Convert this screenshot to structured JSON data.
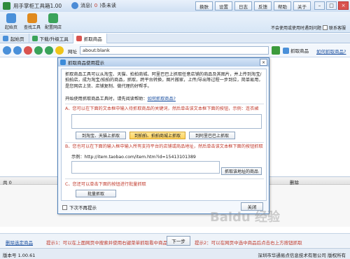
{
  "window": {
    "title": "用手掌柜工具箱1.00",
    "messages": "消息(",
    "messages_count": "0",
    "messages_suffix": ")条未读",
    "buttons": [
      "换肤",
      "设置",
      "日志",
      "反馈",
      "帮助",
      "关于"
    ],
    "minimize": "–",
    "maximize": "□",
    "close": "×"
  },
  "toolbar": {
    "items": [
      {
        "label": "起始页",
        "icon": "home-icon",
        "color": "#4a90d9"
      },
      {
        "label": "查找工具",
        "icon": "search-tool-icon",
        "color": "#e08a1e"
      },
      {
        "label": "配置网店",
        "icon": "shop-config-icon",
        "color": "#3aa35a"
      }
    ],
    "auto_login_label": "不会使用或使用时遇到问题",
    "auto_login_link": "联系客服"
  },
  "tabs": [
    {
      "label": "起始页",
      "active": false,
      "icon": "home-tab-icon",
      "color": "#4a90d9"
    },
    {
      "label": "下载/升级工具",
      "active": false,
      "icon": "download-icon",
      "color": "#3aa35a"
    },
    {
      "label": "抓取商品",
      "active": true,
      "icon": "grab-icon",
      "color": "#d9534f"
    }
  ],
  "navbar": {
    "url_label": "网址",
    "url_value": "about:blank",
    "grab_label": "抓取商品",
    "howto_link": "如何抓取商品?"
  },
  "grid": {
    "columns": [
      "共 0",
      "删除"
    ]
  },
  "footer": {
    "delete_selected": "删除选定商品",
    "tip1": "提示1：可以在上面网页中搜索并使用右键菜单抓取看中商品",
    "next_button": "下一步",
    "tip2": "提示2：可以在网页中选中商品后点击右上方按钮抓取"
  },
  "status": {
    "version": "版本号 1.00.61",
    "copyright": "深圳市华通易点信息技术有限公司 版权所有"
  },
  "dialog": {
    "title": "抓取商品使用提示",
    "intro": "抓取商品工具可以从淘宝、天猫、拍拍商城、阿里巴巴上抓取任意店铺的商品及其图片，并上传到淘宝/拍拍店，成为淘宝/拍拍的商品，抓取，跨平台转换，图片搬家，上传/导出等过程一步到位，简单易用，是您网店上货、店铺复制、做代理的好帮手。",
    "help_prefix": "开始使用抓取商品工具时，请先阅读帮助：",
    "help_link": "如何抓取商品?",
    "section_a": "A、您可以在下面的文本框中输入待抓取商品的关键词，然后单击该文本框下面的按钮，示例：连衣裙",
    "btn_taobao": "到淘宝、天猫上抓取",
    "btn_paipai": "到拍拍、拍拍商城上抓取",
    "btn_alibaba": "到阿里巴巴上抓取",
    "section_b": "B、您也可以在下面的输入框中输入所有支持平台的店铺或商品地址，然后单击该文本框下面的按钮抓取",
    "example": "示例：http://item.taobao.com/item.htm?id=15413101389",
    "btn_grab_address": "抓取该地址的商品",
    "section_c": "C、您还可以单击下面的按钮进行批量抓取",
    "btn_batch": "批量抓取",
    "dont_show": "下次不再提示",
    "close_button": "关闭"
  },
  "watermark": "Baidu 经验",
  "colors": {
    "accent": "#4c7fb9",
    "warning_text": "#c0392b",
    "link": "#1a4fa0",
    "highlight_button": "#ffd25a"
  }
}
